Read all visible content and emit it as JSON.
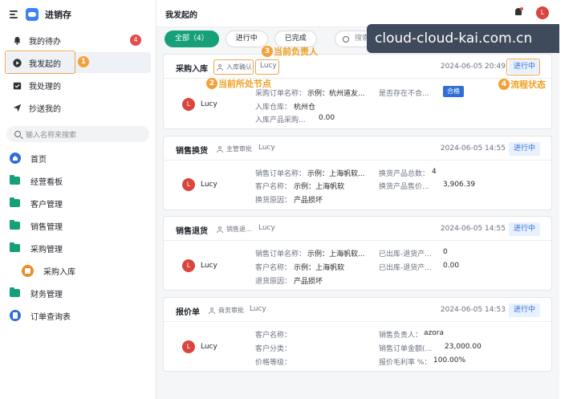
{
  "app": {
    "title": "进销存"
  },
  "sidebar": {
    "nav": [
      {
        "label": "我的待办",
        "badge": "4"
      },
      {
        "label": "我发起的"
      },
      {
        "label": "我处理的"
      },
      {
        "label": "抄送我的"
      }
    ],
    "search_placeholder": "输入名称来搜索",
    "tree": [
      {
        "label": "首页"
      },
      {
        "label": "经营看板"
      },
      {
        "label": "客户管理"
      },
      {
        "label": "销售管理"
      },
      {
        "label": "采购管理"
      },
      {
        "label": "采购入库"
      },
      {
        "label": "财务管理"
      },
      {
        "label": "订单查询表"
      }
    ]
  },
  "header": {
    "title": "我发起的",
    "avatar": "L"
  },
  "filters": {
    "tabs": [
      "全部（4）",
      "进行中",
      "已完成"
    ],
    "search_placeholder": "搜索"
  },
  "watermark": "cloud-cloud-kai.com.cn",
  "annotations": {
    "a1": "1",
    "a2": "2",
    "a2_text": "当前所处节点",
    "a3": "3",
    "a3_text": "当前负责人",
    "a4": "4",
    "a4_text": "流程状态"
  },
  "cards": [
    {
      "title": "采购入库",
      "node": "入库确认",
      "owner": "Lucy",
      "time": "2024-06-05 20:49",
      "status": "进行中",
      "user": "Lucy",
      "avatar": "L",
      "fields": [
        {
          "label": "采购订单名称：",
          "value": "示例：杭州道友..."
        },
        {
          "label": "是否存在不合...",
          "value": "合格"
        },
        {
          "label": "入库仓库：",
          "value": "杭州仓"
        },
        {
          "label": "入库产品采购...",
          "value": "0.00"
        }
      ]
    },
    {
      "title": "销售换货",
      "node": "主管审批",
      "owner": "Lucy",
      "time": "2024-06-05 14:55",
      "status": "进行中",
      "user": "Lucy",
      "avatar": "L",
      "fields": [
        {
          "label": "销售订单名称：",
          "value": "示例：上海帆软..."
        },
        {
          "label": "换货产品总数：",
          "value": "4"
        },
        {
          "label": "客户名称：",
          "value": "示例：上海帆软"
        },
        {
          "label": "换货产品售价...",
          "value": "3,906.39"
        },
        {
          "label": "换货原因：",
          "value": "产品损坏"
        }
      ]
    },
    {
      "title": "销售退货",
      "node": "销售退...",
      "owner": "Lucy",
      "time": "2024-06-05 14:55",
      "status": "进行中",
      "user": "Lucy",
      "avatar": "L",
      "fields": [
        {
          "label": "销售订单名称：",
          "value": "示例：上海帆软..."
        },
        {
          "label": "已出库-退货产...",
          "value": "0"
        },
        {
          "label": "客户名称：",
          "value": "示例：上海帆软"
        },
        {
          "label": "已出库-退货产...",
          "value": "0.00"
        },
        {
          "label": "退货原因：",
          "value": "产品损坏"
        }
      ]
    },
    {
      "title": "报价单",
      "node": "商务审批",
      "owner": "Lucy",
      "time": "2024-06-05 14:53",
      "status": "进行中",
      "user": "Lucy",
      "avatar": "L",
      "fields": [
        {
          "label": "客户名称：",
          "value": ""
        },
        {
          "label": "销售负责人：",
          "value": "azora"
        },
        {
          "label": "客户分类：",
          "value": ""
        },
        {
          "label": "销售订单金额(...",
          "value": "23,000.00"
        },
        {
          "label": "价格等级：",
          "value": ""
        },
        {
          "label": "报价毛利率 %：",
          "value": "100.00%"
        }
      ]
    }
  ]
}
